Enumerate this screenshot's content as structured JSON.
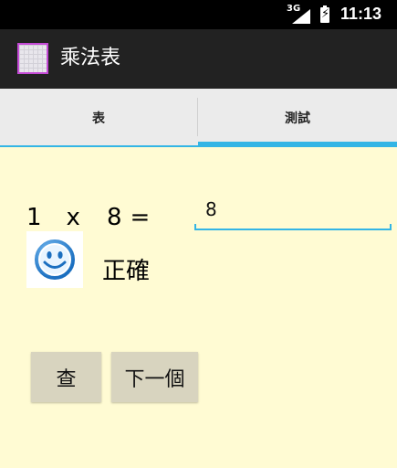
{
  "status_bar": {
    "network": "3G",
    "time": "11:13"
  },
  "app": {
    "title": "乘法表"
  },
  "tabs": [
    {
      "label": "表",
      "selected": false
    },
    {
      "label": "測試",
      "selected": true
    }
  ],
  "question": {
    "a": "1",
    "operator": "x",
    "b": "8",
    "equals": "="
  },
  "answer_input": {
    "value": "8"
  },
  "result": {
    "icon": "smiley-face-icon",
    "text": "正確"
  },
  "buttons": {
    "check": "查",
    "next": "下一個"
  },
  "colors": {
    "accent": "#33b5e5",
    "background": "#fffbd3",
    "action_bar": "#222222",
    "button": "#d8d4bf"
  }
}
